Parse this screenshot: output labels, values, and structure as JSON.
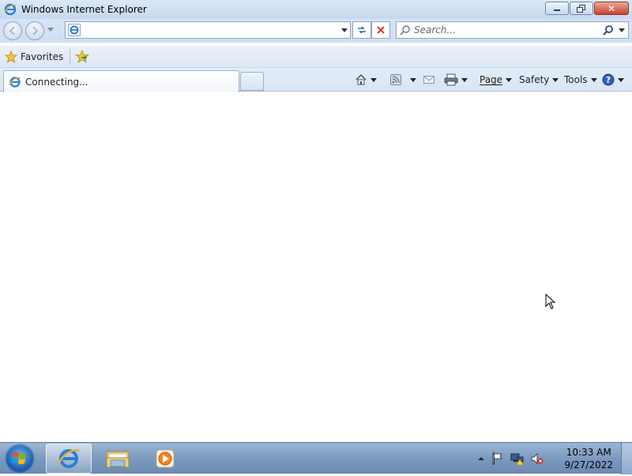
{
  "window": {
    "title": "Windows Internet Explorer",
    "caption_buttons": [
      "minimize",
      "restore",
      "close"
    ]
  },
  "navigation": {
    "address_value": "",
    "search_placeholder": "Search..."
  },
  "favorites_bar": {
    "favorites_label": "Favorites"
  },
  "tabs": [
    {
      "label": "Connecting...",
      "active": true
    }
  ],
  "command_bar": {
    "page_label": "Page",
    "safety_label": "Safety",
    "tools_label": "Tools"
  },
  "taskbar": {
    "pinned": [
      "internet-explorer",
      "windows-explorer",
      "media-player"
    ],
    "active": "internet-explorer",
    "tray_icons": [
      "show-hidden-icons",
      "action-center-flag",
      "network",
      "volume-muted"
    ]
  },
  "clock": {
    "time": "10:33 AM",
    "date": "9/27/2022"
  },
  "colors": {
    "chrome": "#d6e4f5",
    "taskbar": "#7d9ac0",
    "close_button": "#c7432c"
  }
}
